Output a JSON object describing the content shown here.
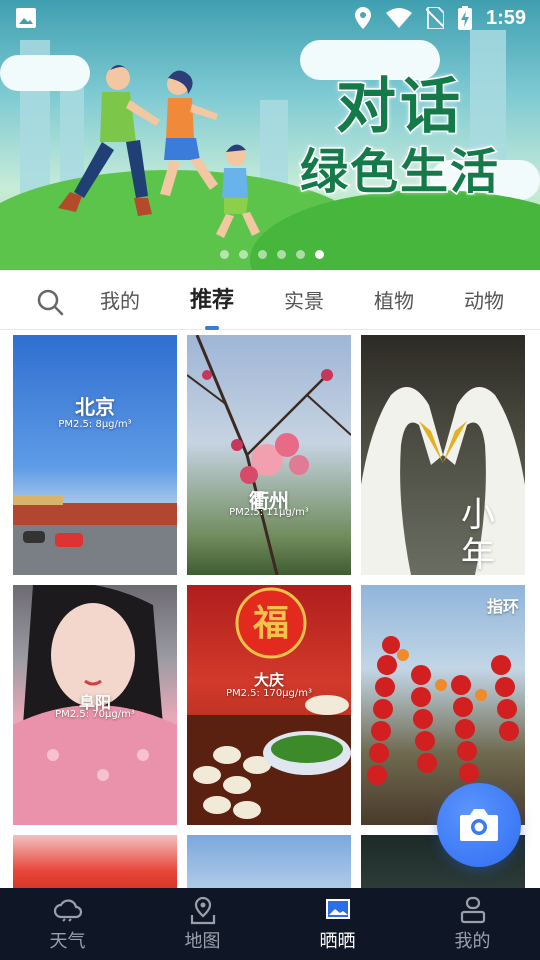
{
  "status_bar": {
    "time": "1:59",
    "icons": [
      "gallery-icon",
      "location-icon",
      "wifi-icon",
      "no-sim-icon",
      "battery-charging-icon"
    ]
  },
  "banner": {
    "title_line1": "对话",
    "title_line2": "绿色生活",
    "slide_count": 6,
    "active_slide": 6
  },
  "tabs": {
    "items": [
      {
        "label": "我的"
      },
      {
        "label": "推荐"
      },
      {
        "label": "实景"
      },
      {
        "label": "植物"
      },
      {
        "label": "动物"
      }
    ],
    "active_index": 1,
    "accent": "#3a7bd5"
  },
  "grid": {
    "cards": [
      {
        "location": "北京",
        "pm": "PM2.5: 8μg/m³"
      },
      {
        "location": "衢州",
        "pm": "PM2.5: 11μg/m³"
      },
      {
        "overlay": "小年"
      },
      {
        "location": "阜阳",
        "pm": "PM2.5: 70μg/m³"
      },
      {
        "location": "大庆",
        "pm": "PM2.5: 170μg/m³"
      },
      {
        "overlay": "指环"
      }
    ]
  },
  "bottom_nav": {
    "items": [
      {
        "label": "天气",
        "icon": "cloud-icon"
      },
      {
        "label": "地图",
        "icon": "map-pin-icon"
      },
      {
        "label": "晒晒",
        "icon": "photo-icon"
      },
      {
        "label": "我的",
        "icon": "profile-icon"
      }
    ],
    "active_index": 2
  }
}
